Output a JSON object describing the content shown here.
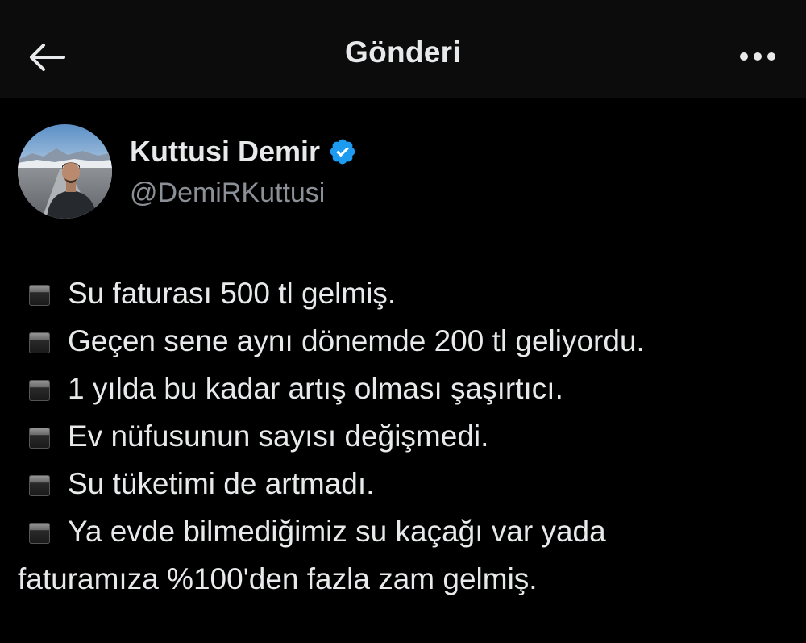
{
  "header": {
    "title": "Gönderi",
    "back_icon": "arrow-left-icon",
    "more_icon": "more-horizontal-icon"
  },
  "author": {
    "display_name": "Kuttusi Demir",
    "handle": "@DemiRKuttusi",
    "verified_icon": "verified-badge-icon",
    "verified_color": "#1d9bf0"
  },
  "tweet": {
    "bullet_icon": "black-square-emoji-icon",
    "lines": [
      "Su faturası 500 tl gelmiş.",
      "Geçen sene aynı dönemde 200 tl geliyordu.",
      "1 yılda bu kadar artış olması şaşırtıcı.",
      "Ev nüfusunun sayısı değişmedi.",
      "Su tüketimi de artmadı.",
      "Ya evde bilmediğimiz su kaçağı var yada",
      "faturamıza %100'den fazla zam gelmiş."
    ]
  }
}
